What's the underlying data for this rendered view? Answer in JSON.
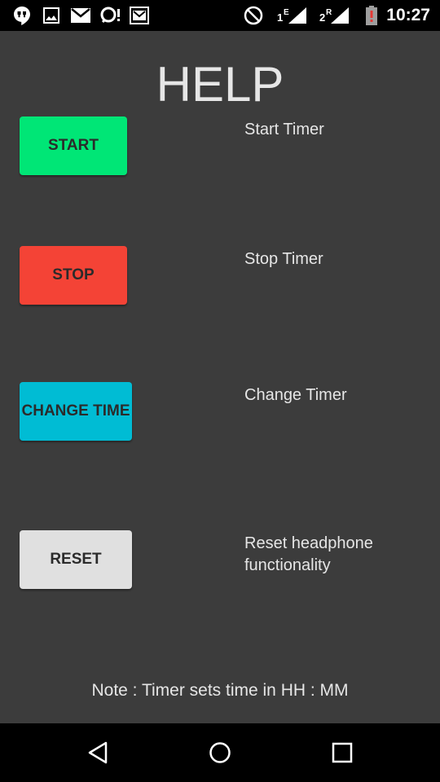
{
  "status_bar": {
    "time": "10:27",
    "left_icons": [
      "hangouts-icon",
      "image-icon",
      "gmail-icon",
      "voicemail-icon",
      "photo-mail-icon"
    ],
    "right_icons": [
      "do-not-disturb-icon",
      "signal-sim1-icon",
      "signal-sim2-icon",
      "battery-low-icon"
    ],
    "sim1_label": "1",
    "sim1_type": "E",
    "sim2_label": "2",
    "sim2_type": "R",
    "battery_warning_color": "#e53935"
  },
  "page": {
    "title": "HELP",
    "background_color": "#3c3c3c"
  },
  "items": [
    {
      "button_label": "START",
      "button_color": "#00e676",
      "description": "Start Timer"
    },
    {
      "button_label": "STOP",
      "button_color": "#f44336",
      "description": "Stop Timer"
    },
    {
      "button_label": "CHANGE TIME",
      "button_color": "#00bcd4",
      "description": "Change Timer"
    },
    {
      "button_label": "RESET",
      "button_color": "#e0e0e0",
      "description": "Reset headphone functionality"
    }
  ],
  "note": "Note : Timer sets time in HH : MM",
  "nav_bar": {
    "icons": [
      "back-icon",
      "home-icon",
      "recents-icon"
    ]
  }
}
